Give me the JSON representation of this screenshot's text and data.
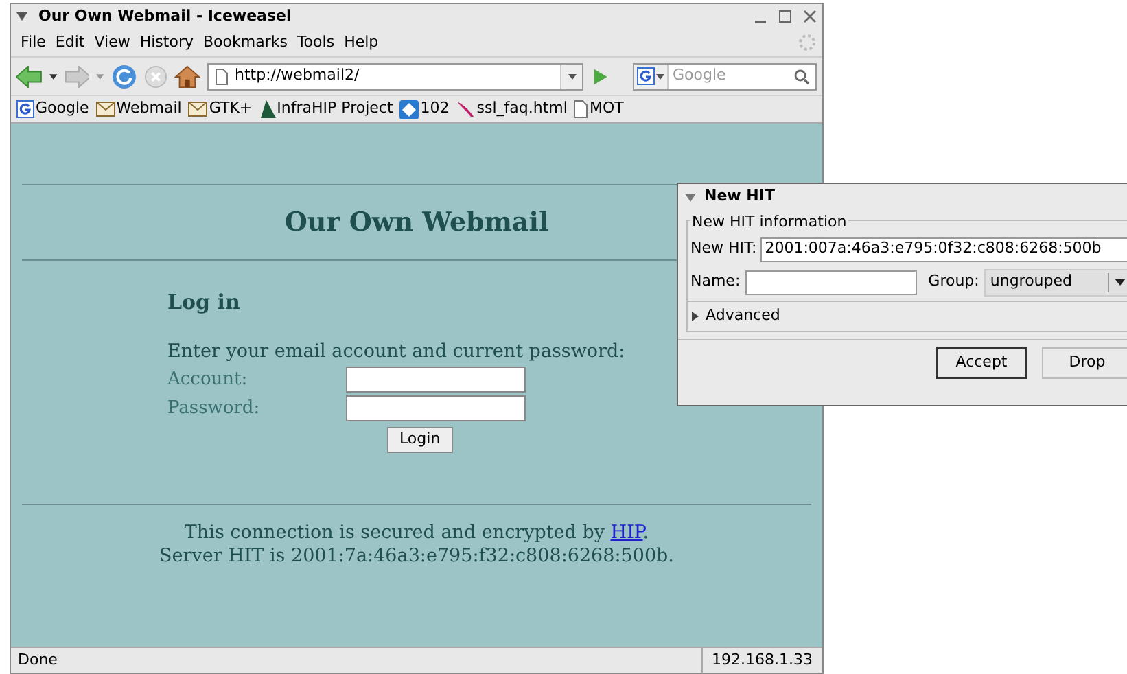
{
  "window": {
    "title": "Our Own Webmail - Iceweasel"
  },
  "menu": [
    "File",
    "Edit",
    "View",
    "History",
    "Bookmarks",
    "Tools",
    "Help"
  ],
  "toolbar": {
    "url": "http://webmail2/",
    "search_placeholder": "Google"
  },
  "bookmarks": [
    {
      "label": "Google",
      "kind": "google"
    },
    {
      "label": "Webmail",
      "kind": "mail"
    },
    {
      "label": "GTK+",
      "kind": "mail"
    },
    {
      "label": "InfraHIP Project",
      "kind": "tree"
    },
    {
      "label": "102",
      "kind": "puzzle"
    },
    {
      "label": "ssl_faq.html",
      "kind": "feather"
    },
    {
      "label": "MOT",
      "kind": "page"
    }
  ],
  "page": {
    "heading": "Our Own Webmail",
    "login_heading": "Log in",
    "prompt": "Enter your email account and current password:",
    "account_label": "Account:",
    "password_label": "Password:",
    "login_button": "Login",
    "footer_before": "This connection is secured and encrypted by",
    "footer_link": "HIP",
    "footer_after": ".",
    "footer_line2": "Server HIT is 2001:7a:46a3:e795:f32:c808:6268:500b."
  },
  "status_bar": {
    "text": "Done",
    "address": "192.168.1.33"
  },
  "dialog": {
    "title": "New HIT",
    "group_title": "New HIT information",
    "hit_label": "New HIT:",
    "hit_value": "2001:007a:46a3:e795:0f32:c808:6268:500b",
    "name_label": "Name:",
    "group_label": "Group:",
    "group_value": "ungrouped",
    "advanced": "Advanced",
    "expanded": false,
    "buttons": [
      {
        "label": "Accept",
        "default": true
      },
      {
        "label": "Drop",
        "default": false
      }
    ]
  }
}
